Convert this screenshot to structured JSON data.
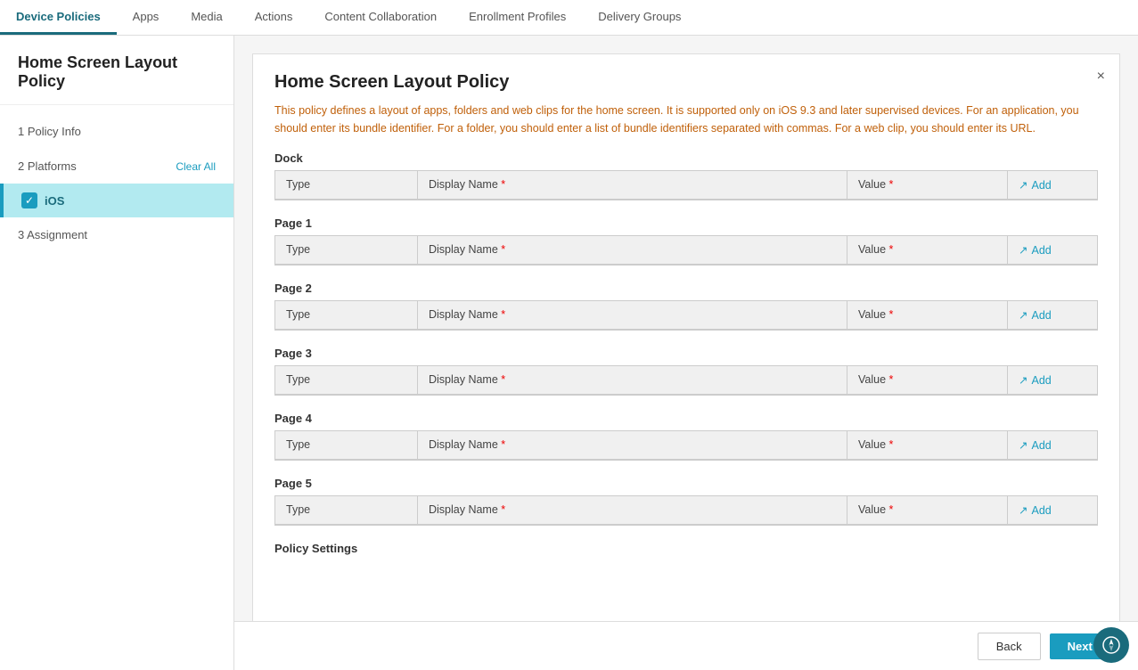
{
  "nav": {
    "items": [
      {
        "label": "Device Policies",
        "active": true
      },
      {
        "label": "Apps",
        "active": false
      },
      {
        "label": "Media",
        "active": false
      },
      {
        "label": "Actions",
        "active": false
      },
      {
        "label": "Content Collaboration",
        "active": false
      },
      {
        "label": "Enrollment Profiles",
        "active": false
      },
      {
        "label": "Delivery Groups",
        "active": false
      }
    ]
  },
  "sidebar": {
    "title": "Home Screen Layout Policy",
    "step1_label": "1  Policy Info",
    "step2_label": "2  Platforms",
    "clear_all_label": "Clear All",
    "ios_label": "iOS",
    "step3_label": "3  Assignment"
  },
  "policy": {
    "title": "Home Screen Layout Policy",
    "description": "This policy defines a layout of apps, folders and web clips for the home screen. It is supported only on iOS 9.3 and later supervised devices. For an application, you should enter its bundle identifier. For a folder, you should enter a list of bundle identifiers separated with commas. For a web clip, you should enter its URL.",
    "close_label": "×",
    "dock_label": "Dock",
    "page1_label": "Page 1",
    "page2_label": "Page 2",
    "page3_label": "Page 3",
    "page4_label": "Page 4",
    "page5_label": "Page 5",
    "policy_settings_label": "Policy Settings",
    "columns": {
      "type": "Type",
      "display_name": "Display Name",
      "value": "Value",
      "add": "Add"
    }
  },
  "footer": {
    "back_label": "Back",
    "next_label": "Next >"
  },
  "colors": {
    "accent": "#1a9cbf",
    "nav_active": "#1a6b7c",
    "required": "#e00000",
    "description": "#c0600a"
  }
}
